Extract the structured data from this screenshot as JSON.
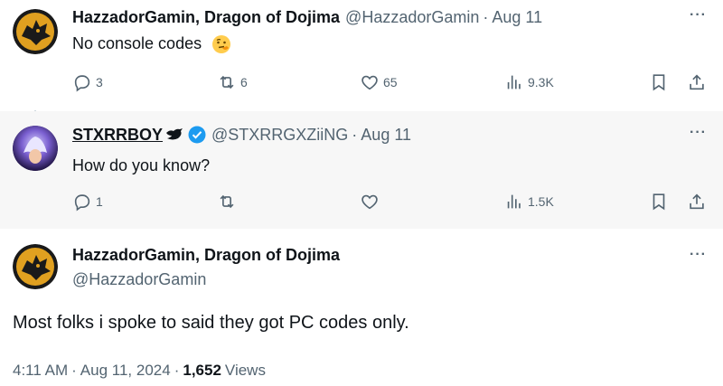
{
  "thread": [
    {
      "name": "HazzadorGamin, Dragon of Dojima",
      "handle": "@HazzadorGamin",
      "sep": "·",
      "date": "Aug 11",
      "text": "No console codes",
      "emoji_icon": "thinking-face-emoji",
      "more": "···",
      "replies": "3",
      "reposts": "6",
      "likes": "65",
      "views": "9.3K"
    },
    {
      "name": "STXRRBOY",
      "handle": "@STXRRGXZiiNG",
      "sep": "·",
      "date": "Aug 11",
      "text": "How do you know?",
      "more": "···",
      "replies": "1",
      "reposts": "",
      "likes": "",
      "views": "1.5K"
    }
  ],
  "main_tweet": {
    "name": "HazzadorGamin, Dragon of Dojima",
    "handle": "@HazzadorGamin",
    "text": "Most folks i spoke to said they got PC codes only.",
    "time": "4:11 AM",
    "sep1": "·",
    "date": "Aug 11, 2024",
    "sep2": "·",
    "views_count": "1,652",
    "views_label": "Views",
    "more": "···"
  },
  "colors": {
    "secondary_text": "#536471",
    "primary_text": "#0f1419",
    "verified_blue": "#1d9bf0",
    "thread_line": "#cfd9de"
  }
}
